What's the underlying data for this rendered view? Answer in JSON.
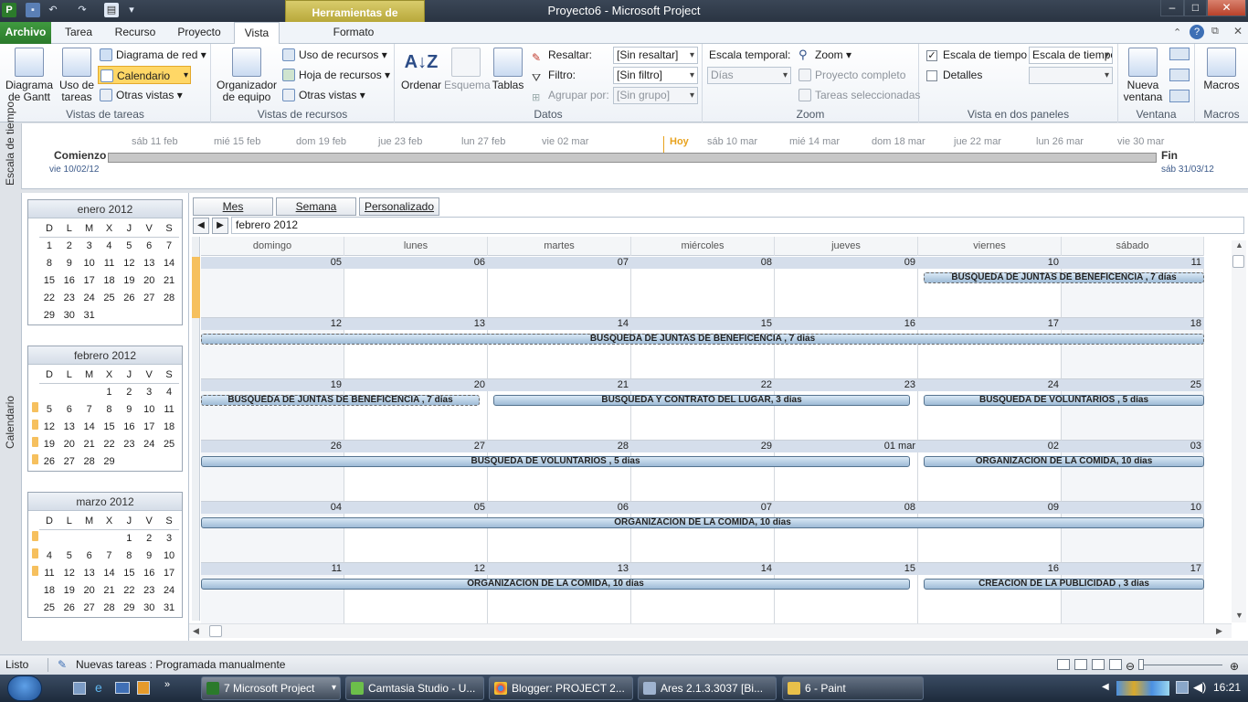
{
  "window": {
    "title": "Proyecto6  -  Microsoft Project",
    "context_tab": "Herramientas de calendario"
  },
  "tabs": [
    "Archivo",
    "Tarea",
    "Recurso",
    "Proyecto",
    "Vista",
    "Formato"
  ],
  "ribbon": {
    "task_views": {
      "gantt": "Diagrama de Gantt",
      "task_usage": "Uso de tareas",
      "network": "Diagrama de red",
      "calendar": "Calendario",
      "other_views": "Otras vistas",
      "label": "Vistas de tareas"
    },
    "resource_views": {
      "team_planner": "Organizador de equipo",
      "resource_usage": "Uso de recursos",
      "resource_sheet": "Hoja de recursos",
      "other_views": "Otras vistas",
      "label": "Vistas de recursos"
    },
    "data": {
      "sort": "Ordenar",
      "outline": "Esquema",
      "tables": "Tablas",
      "highlight_label": "Resaltar:",
      "highlight_value": "[Sin resaltar]",
      "filter_label": "Filtro:",
      "filter_value": "[Sin filtro]",
      "group_label": "Agrupar por:",
      "group_value": "[Sin grupo]",
      "label": "Datos"
    },
    "zoom": {
      "timescale_label": "Escala temporal:",
      "timescale_value": "Días",
      "zoom": "Zoom",
      "entire_project": "Proyecto completo",
      "selected_tasks": "Tareas seleccionadas",
      "label": "Zoom"
    },
    "split_view": {
      "timeline_check": "Escala de tiempo",
      "timeline_value": "Escala de tiempo",
      "details_check": "Detalles",
      "label": "Vista en dos paneles"
    },
    "window": {
      "new_window": "Nueva ventana",
      "label": "Ventana"
    },
    "macros": {
      "macros": "Macros",
      "label": "Macros"
    }
  },
  "timeline": {
    "side_label": "Escala de tiempo",
    "start_label": "Comienzo",
    "start_date": "vie 10/02/12",
    "end_label": "Fin",
    "end_date": "sáb 31/03/12",
    "today_label": "Hoy",
    "dates": [
      "sáb 11 feb",
      "mié 15 feb",
      "dom 19 feb",
      "jue 23 feb",
      "lun 27 feb",
      "vie 02 mar",
      "sáb 10 mar",
      "mié 14 mar",
      "dom 18 mar",
      "jue 22 mar",
      "lun 26 mar",
      "vie 30 mar"
    ]
  },
  "side_label": "Calendario",
  "mini_calendars": [
    {
      "title": "enero 2012",
      "days_header": [
        "D",
        "L",
        "M",
        "X",
        "J",
        "V",
        "S"
      ],
      "weeks": [
        [
          "1",
          "2",
          "3",
          "4",
          "5",
          "6",
          "7"
        ],
        [
          "8",
          "9",
          "10",
          "11",
          "12",
          "13",
          "14"
        ],
        [
          "15",
          "16",
          "17",
          "18",
          "19",
          "20",
          "21"
        ],
        [
          "22",
          "23",
          "24",
          "25",
          "26",
          "27",
          "28"
        ],
        [
          "29",
          "30",
          "31",
          "",
          "",
          "",
          ""
        ]
      ]
    },
    {
      "title": "febrero 2012",
      "days_header": [
        "D",
        "L",
        "M",
        "X",
        "J",
        "V",
        "S"
      ],
      "weeks": [
        [
          "",
          "",
          "",
          "1",
          "2",
          "3",
          "4"
        ],
        [
          "5",
          "6",
          "7",
          "8",
          "9",
          "10",
          "11"
        ],
        [
          "12",
          "13",
          "14",
          "15",
          "16",
          "17",
          "18"
        ],
        [
          "19",
          "20",
          "21",
          "22",
          "23",
          "24",
          "25"
        ],
        [
          "26",
          "27",
          "28",
          "29",
          "",
          "",
          ""
        ]
      ]
    },
    {
      "title": "marzo 2012",
      "days_header": [
        "D",
        "L",
        "M",
        "X",
        "J",
        "V",
        "S"
      ],
      "weeks": [
        [
          "",
          "",
          "",
          "",
          "1",
          "2",
          "3"
        ],
        [
          "4",
          "5",
          "6",
          "7",
          "8",
          "9",
          "10"
        ],
        [
          "11",
          "12",
          "13",
          "14",
          "15",
          "16",
          "17"
        ],
        [
          "18",
          "19",
          "20",
          "21",
          "22",
          "23",
          "24"
        ],
        [
          "25",
          "26",
          "27",
          "28",
          "29",
          "30",
          "31"
        ]
      ]
    }
  ],
  "calendar": {
    "view_buttons": [
      "Mes",
      "Semana",
      "Personalizado"
    ],
    "month_label": "febrero 2012",
    "weekdays": [
      "domingo",
      "lunes",
      "martes",
      "miércoles",
      "jueves",
      "viernes",
      "sábado"
    ],
    "weeks": [
      {
        "days": [
          "05",
          "06",
          "07",
          "08",
          "09",
          "10",
          "11"
        ]
      },
      {
        "days": [
          "12",
          "13",
          "14",
          "15",
          "16",
          "17",
          "18"
        ]
      },
      {
        "days": [
          "19",
          "20",
          "21",
          "22",
          "23",
          "24",
          "25"
        ]
      },
      {
        "days": [
          "26",
          "27",
          "28",
          "29",
          "01 mar",
          "02",
          "03"
        ]
      },
      {
        "days": [
          "04",
          "05",
          "06",
          "07",
          "08",
          "09",
          "10"
        ]
      },
      {
        "days": [
          "11",
          "12",
          "13",
          "14",
          "15",
          "16",
          "17"
        ]
      }
    ],
    "tasks": {
      "juntas": "BUSQUEDA DE JUNTAS DE BENEFICENCIA , 7 días",
      "lugar": "BUSQUEDA Y CONTRATO DEL LUGAR, 3 días",
      "voluntarios": "BUSQUEDA DE VOLUNTARIOS , 5 días",
      "comida": "ORGANIZACIÓN DE LA COMIDA, 10 días",
      "publicidad": "CREACION DE LA PUBLICIDAD , 3 días"
    }
  },
  "status": {
    "mode": "Listo",
    "new_tasks": "Nuevas tareas : Programada manualmente"
  },
  "taskbar": {
    "items": [
      "7 Microsoft Project",
      "Camtasia Studio - U...",
      "Blogger: PROJECT 2...",
      "Ares 2.1.3.3037   [Bi...",
      "6 - Paint"
    ],
    "clock": "16:21"
  },
  "colors": {
    "file_tab": "#2b7a2b",
    "task_bar": "#9ebbd6",
    "context_tab": "#c8b948",
    "marker": "#f6c05e"
  }
}
